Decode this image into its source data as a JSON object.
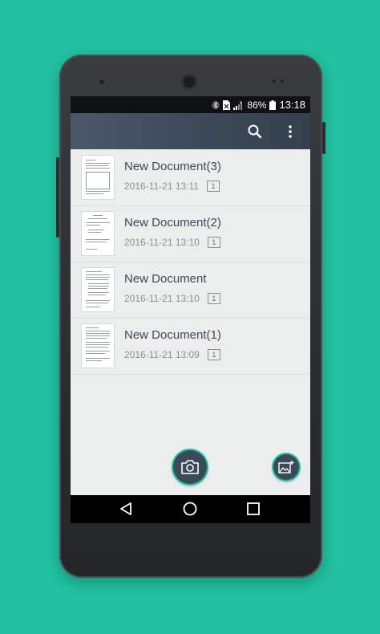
{
  "status_bar": {
    "battery_percent": "86%",
    "time": "13:18",
    "icons": [
      "bluetooth-icon",
      "sim-icon",
      "signal-icon",
      "battery-icon"
    ]
  },
  "app_bar": {
    "icons": [
      "search-icon",
      "more-vert-icon"
    ]
  },
  "documents": [
    {
      "title": "New Document(3)",
      "date": "2016-11-21 13:11",
      "pages": "1"
    },
    {
      "title": "New Document(2)",
      "date": "2016-11-21 13:10",
      "pages": "1"
    },
    {
      "title": "New Document",
      "date": "2016-11-21 13:10",
      "pages": "1"
    },
    {
      "title": "New Document(1)",
      "date": "2016-11-21 13:09",
      "pages": "1"
    }
  ],
  "fabs": {
    "camera": "camera-icon",
    "gallery": "gallery-icon"
  },
  "nav": {
    "icons": [
      "back-icon",
      "home-icon",
      "recents-icon"
    ]
  },
  "colors": {
    "background": "#22c1a1",
    "app_bar": "#3c4a59",
    "list_bg": "#eceeee",
    "title_text": "#3a4a5a",
    "meta_text": "#8a9090"
  }
}
